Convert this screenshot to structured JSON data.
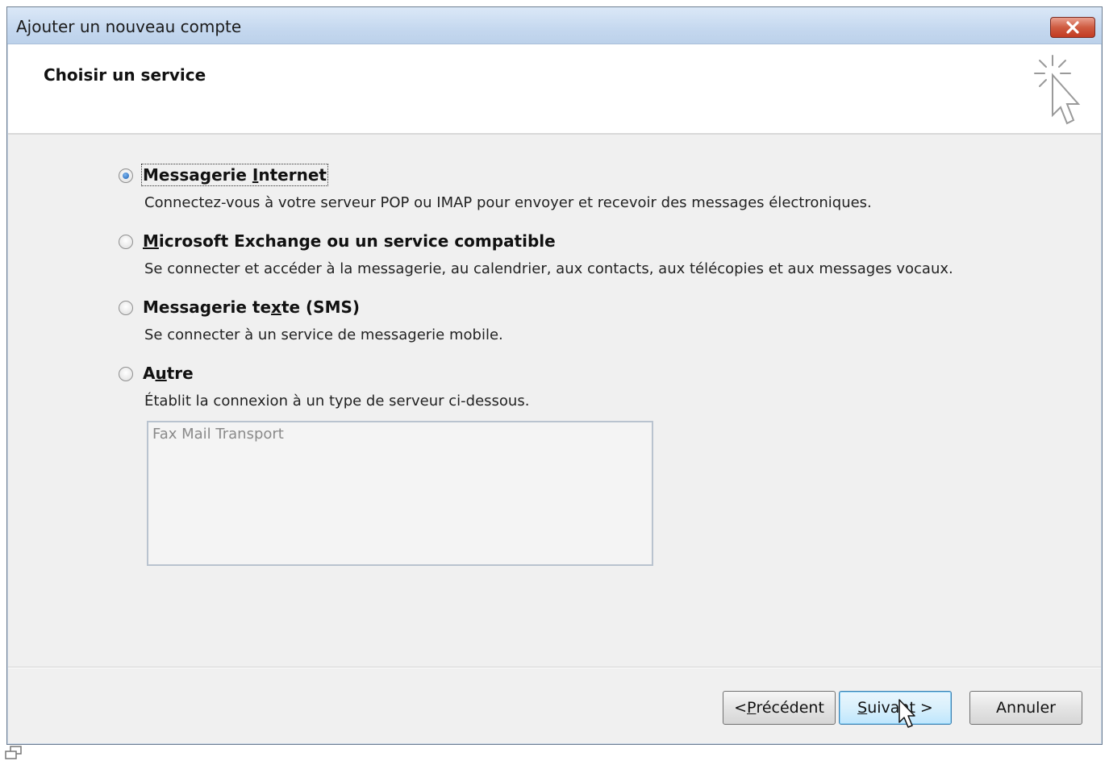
{
  "window": {
    "title": "Ajouter un nouveau compte",
    "close_icon": "close-icon"
  },
  "header": {
    "title": "Choisir un service",
    "icon": "wizard-cursor-icon"
  },
  "options": [
    {
      "label_pre": "Messagerie ",
      "label_u": "I",
      "label_post": "nternet",
      "description": "Connectez-vous à votre serveur POP ou IMAP pour envoyer et recevoir des messages électroniques.",
      "selected": true
    },
    {
      "label_pre": "",
      "label_u": "M",
      "label_post": "icrosoft Exchange ou un service compatible",
      "description": "Se connecter et accéder à la messagerie, au calendrier, aux contacts, aux télécopies et aux messages vocaux.",
      "selected": false
    },
    {
      "label_pre": "Messagerie te",
      "label_u": "x",
      "label_post": "te (SMS)",
      "description": "Se connecter à un service de messagerie mobile.",
      "selected": false
    },
    {
      "label_pre": "A",
      "label_u": "u",
      "label_post": "tre",
      "description": "Établit la connexion à un type de serveur ci-dessous.",
      "selected": false
    }
  ],
  "server_list": {
    "items": [
      "Fax Mail Transport"
    ]
  },
  "buttons": {
    "previous_pre": "< ",
    "previous_u": "P",
    "previous_post": "récédent",
    "next_u": "S",
    "next_post": "uivant >",
    "cancel": "Annuler"
  }
}
